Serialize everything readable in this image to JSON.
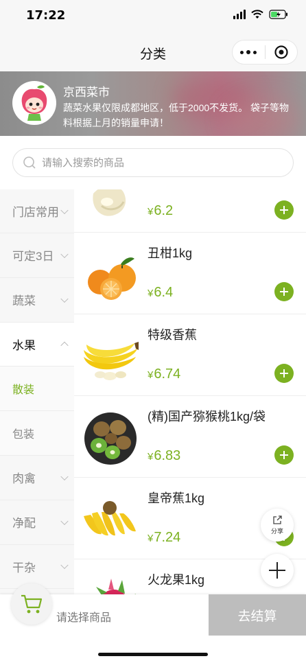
{
  "status_bar": {
    "time": "17:22"
  },
  "nav": {
    "title": "分类"
  },
  "banner": {
    "store_name": "京西菜市",
    "notice": "蔬菜水果仅限成都地区，低于2000不发货。 袋子等物料根据上月的销量申请！"
  },
  "search": {
    "placeholder": "请输入搜索的商品"
  },
  "categories": [
    {
      "label": "门店常用"
    },
    {
      "label": "可定3日"
    },
    {
      "label": "蔬菜"
    },
    {
      "label": "水果"
    },
    {
      "label": "散装"
    },
    {
      "label": "包装"
    },
    {
      "label": "肉禽"
    },
    {
      "label": "净配"
    },
    {
      "label": "干杂"
    }
  ],
  "products": [
    {
      "name": "",
      "currency": "¥",
      "price": "6.2"
    },
    {
      "name": "丑柑1kg",
      "currency": "¥",
      "price": "6.4"
    },
    {
      "name": "特级香蕉",
      "currency": "¥",
      "price": "6.74"
    },
    {
      "name": "(精)国产猕猴桃1kg/袋",
      "currency": "¥",
      "price": "6.83"
    },
    {
      "name": "皇帝蕉1kg",
      "currency": "¥",
      "price": "7.24"
    },
    {
      "name": "火龙果1kg",
      "currency": "¥",
      "price": ""
    }
  ],
  "share": {
    "label": "分享"
  },
  "cart": {
    "hint": "请选择商品",
    "checkout_label": "去结算"
  },
  "colors": {
    "accent": "#7cb121",
    "checkout_disabled": "#bdbdbd"
  }
}
